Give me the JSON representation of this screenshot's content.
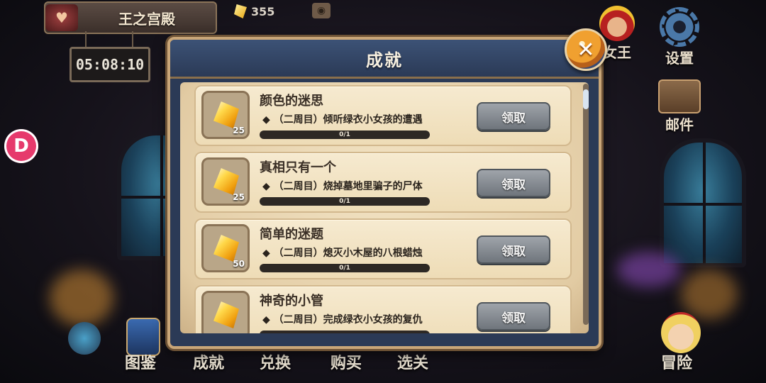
{
  "top_bar": {
    "location_title": "王之宫殿",
    "crystal_count": "355",
    "timer": "05:08:10"
  },
  "right_menu": {
    "queen_label": "女王",
    "settings_label": "设置",
    "mail_label": "邮件"
  },
  "left_button": {
    "label": "D"
  },
  "bottom_nav": {
    "items": [
      "图鉴",
      "成就",
      "兑换",
      "购买",
      "选关",
      "冒险"
    ]
  },
  "dialog": {
    "title": "成就",
    "close_symbol": "✕",
    "achievements": [
      {
        "name": "颜色的迷思",
        "description": "◆ （二周目）倾听绿衣小女孩的遭遇",
        "reward_qty": "25",
        "progress_text": "0/1",
        "progress": 0,
        "claim_label": "领取"
      },
      {
        "name": "真相只有一个",
        "description": "◆ （二周目）烧掉墓地里骗子的尸体",
        "reward_qty": "25",
        "progress_text": "0/1",
        "progress": 0,
        "claim_label": "领取"
      },
      {
        "name": "简单的迷题",
        "description": "◆ （二周目）熄灭小木屋的八根蜡烛",
        "reward_qty": "50",
        "progress_text": "0/1",
        "progress": 0,
        "claim_label": "领取"
      },
      {
        "name": "神奇的小管",
        "description": "◆ （二周目）完成绿衣小女孩的复仇",
        "reward_qty": "",
        "progress_text": "",
        "progress": 0,
        "claim_label": "领取"
      }
    ]
  }
}
